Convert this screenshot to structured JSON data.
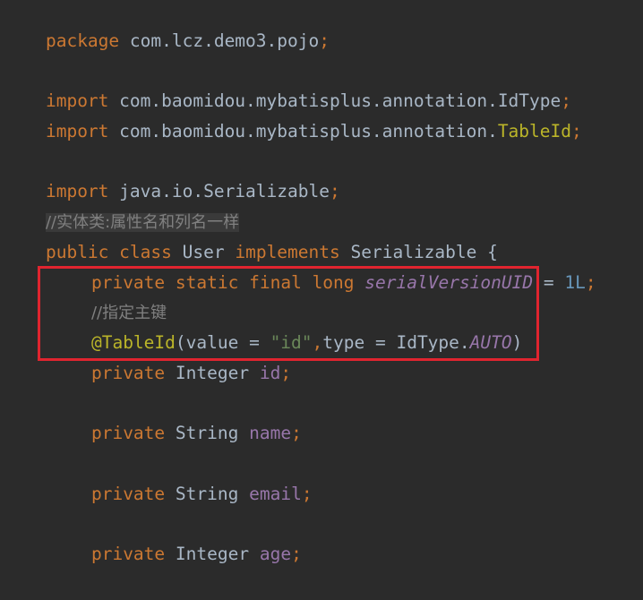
{
  "code": {
    "package_kw": "package",
    "package_name": "com.lcz.demo3.pojo",
    "semi": ";",
    "import_kw": "import",
    "import1_path": "com.baomidou.mybatisplus.annotation.",
    "import1_class": "IdType",
    "import2_path": "com.baomidou.mybatisplus.annotation.",
    "import2_class": "TableId",
    "import3_path": "java.io.Serializable",
    "comment_class": "//实体类:属性名和列名一样",
    "public_kw": "public",
    "class_kw": "class",
    "class_name": "User",
    "implements_kw": "implements",
    "interface_name": "Serializable",
    "open_brace": "{",
    "private_kw": "private",
    "static_kw": "static",
    "final_kw": "final",
    "long_kw": "long",
    "serial_field": "serialVersionUID",
    "eq": " = ",
    "serial_value": "1L",
    "comment_pk": "//指定主键",
    "annotation": "@TableId",
    "ann_open": "(value = ",
    "ann_value": "\"id\"",
    "ann_comma": ",",
    "ann_type": "type = IdType.",
    "ann_auto": "AUTO",
    "ann_close": ")",
    "type_integer": "Integer",
    "type_string": "String",
    "field_id": "id",
    "field_name": "name",
    "field_email": "email",
    "field_age": "age"
  },
  "colors": {
    "background": "#2b2b2b",
    "keyword": "#cc7832",
    "annotation": "#bbb529",
    "string": "#6a8759",
    "number": "#6897bb",
    "field": "#9876aa",
    "comment": "#808080",
    "highlight_box": "#e0242f"
  }
}
